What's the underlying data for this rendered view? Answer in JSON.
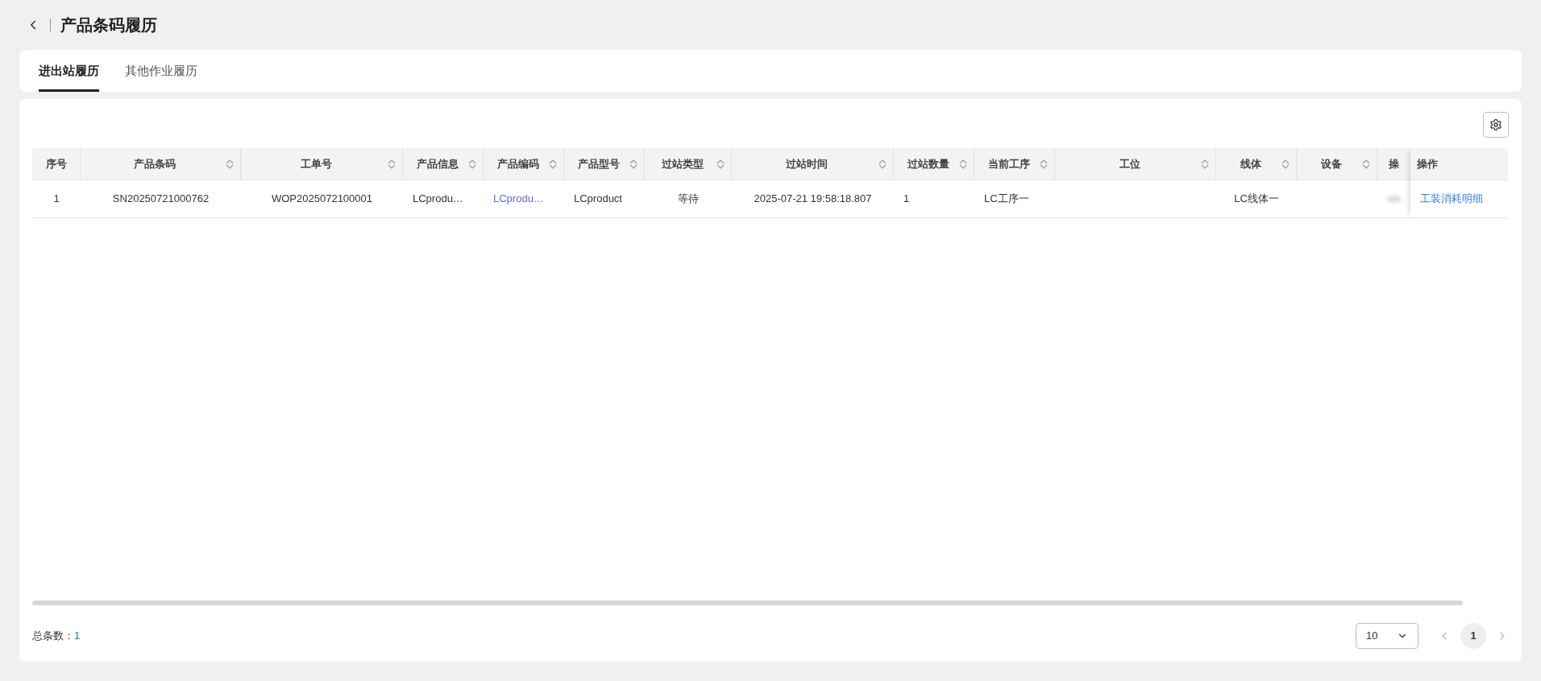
{
  "page_title": "产品条码履历",
  "tabs": [
    {
      "label": "进出站履历",
      "selected": true
    },
    {
      "label": "其他作业履历",
      "selected": false
    }
  ],
  "table": {
    "columns": [
      {
        "title": "序号",
        "sortable": false
      },
      {
        "title": "产品条码",
        "sortable": true
      },
      {
        "title": "工单号",
        "sortable": true
      },
      {
        "title": "产品信息",
        "sortable": true
      },
      {
        "title": "产品编码",
        "sortable": true
      },
      {
        "title": "产品型号",
        "sortable": true
      },
      {
        "title": "过站类型",
        "sortable": true
      },
      {
        "title": "过站时间",
        "sortable": true
      },
      {
        "title": "过站数量",
        "sortable": true
      },
      {
        "title": "当前工序",
        "sortable": true
      },
      {
        "title": "工位",
        "sortable": true
      },
      {
        "title": "线体",
        "sortable": true
      },
      {
        "title": "设备",
        "sortable": true
      },
      {
        "title": "操",
        "sortable": false
      }
    ],
    "rows": [
      {
        "cells": [
          {
            "text": "1",
            "kind": "text"
          },
          {
            "text": "SN20250721000762",
            "kind": "text"
          },
          {
            "text": "WOP2025072100001",
            "kind": "text"
          },
          {
            "text": "LCprodu…",
            "kind": "text"
          },
          {
            "text": "LCprodu…",
            "kind": "link"
          },
          {
            "text": "LCproduct",
            "kind": "text"
          },
          {
            "text": "等待",
            "kind": "text"
          },
          {
            "text": "2025-07-21 19:58:18.807",
            "kind": "text"
          },
          {
            "text": "1",
            "kind": "text"
          },
          {
            "text": "LC工序一",
            "kind": "text"
          },
          {
            "text": "",
            "kind": "text"
          },
          {
            "text": "LC线体一",
            "kind": "text"
          },
          {
            "text": "",
            "kind": "text"
          },
          {
            "text": "",
            "kind": "blurred"
          }
        ],
        "action": "工装消耗明细"
      }
    ],
    "action_column": "操作"
  },
  "footer": {
    "total_label": "总条数：",
    "total": "1",
    "page_size": "10",
    "pages": [
      {
        "label": "1",
        "selected": true
      }
    ]
  }
}
